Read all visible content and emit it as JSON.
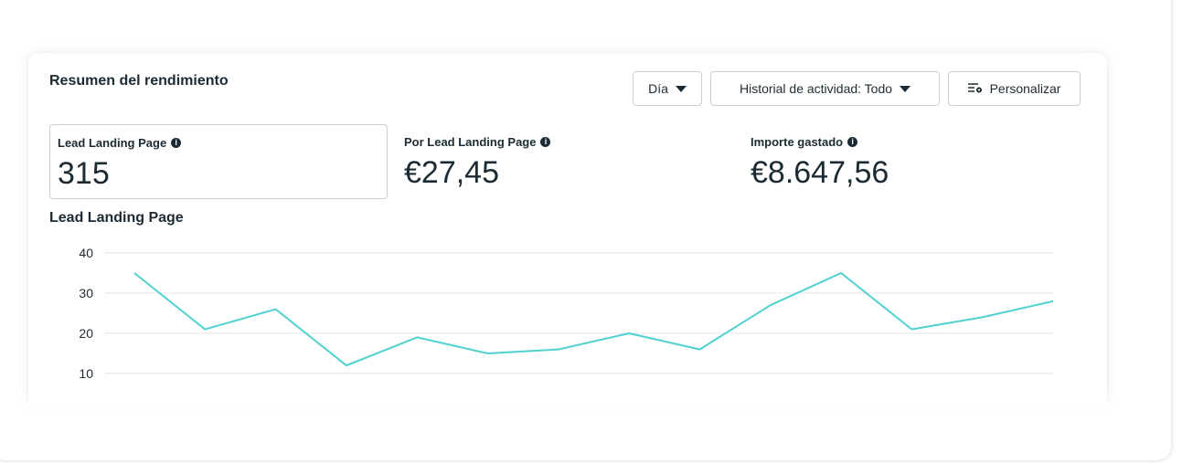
{
  "summary": {
    "title": "Resumen del rendimiento"
  },
  "controls": {
    "day_label": "Día",
    "history_label": "Historial de actividad: Todo",
    "customize_label": "Personalizar"
  },
  "metrics": [
    {
      "label": "Lead Landing Page",
      "value": "315"
    },
    {
      "label": "Por Lead Landing Page",
      "value": "€27,45"
    },
    {
      "label": "Importe gastado",
      "value": "€8.647,56"
    }
  ],
  "icons": {
    "info": "info-icon",
    "caret": "caret-down-icon",
    "customize": "settings-sliders-icon"
  },
  "colors": {
    "line": "#4fd1d1",
    "grid": "#e4e6eb",
    "text": "#1c2b33"
  },
  "chart_data": {
    "type": "line",
    "title": "Lead Landing Page",
    "x": [
      1,
      2,
      3,
      4,
      5,
      6,
      7,
      8,
      9,
      10,
      11,
      12,
      13,
      14
    ],
    "y": [
      35,
      21,
      26,
      12,
      19,
      15,
      16,
      20,
      16,
      27,
      35,
      21,
      24,
      28
    ],
    "yticks": [
      10,
      20,
      30,
      40
    ],
    "ylim": [
      10,
      40
    ],
    "grid": true,
    "legend": "none"
  }
}
